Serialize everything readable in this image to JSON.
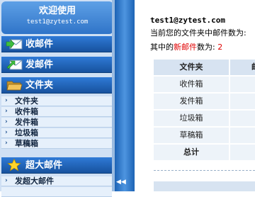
{
  "sidebar": {
    "welcome_title": "欢迎使用",
    "user_email": "test1@zytest.com",
    "sections": {
      "inbox": "收邮件",
      "compose": "发邮件",
      "folders": "文件夹",
      "large_mail": "超大邮件"
    },
    "folder_items": [
      {
        "label": "文件夹"
      },
      {
        "label": "收件箱"
      },
      {
        "label": "发件箱"
      },
      {
        "label": "垃圾箱"
      },
      {
        "label": "草稿箱"
      }
    ],
    "large_mail_items": [
      {
        "label": "发超大邮件"
      }
    ],
    "collapse_arrow": "◀◀"
  },
  "main": {
    "email": "test1@zytest.com",
    "count_prefix": "当前您的文件夹中邮件数为:",
    "new_count_prefix": "其中的",
    "new_word": "新邮件",
    "new_count_suffix": "数为:",
    "new_count_value": "2",
    "table": {
      "header_folder": "文件夹",
      "header_col2": "邮",
      "rows": [
        "收件箱",
        "发件箱",
        "垃圾箱",
        "草稿箱",
        "总计"
      ]
    }
  },
  "colors": {
    "accent": "#2f74c8",
    "new_mail_red": "#e00000",
    "sidebar_bg": "#cfe0f4"
  }
}
